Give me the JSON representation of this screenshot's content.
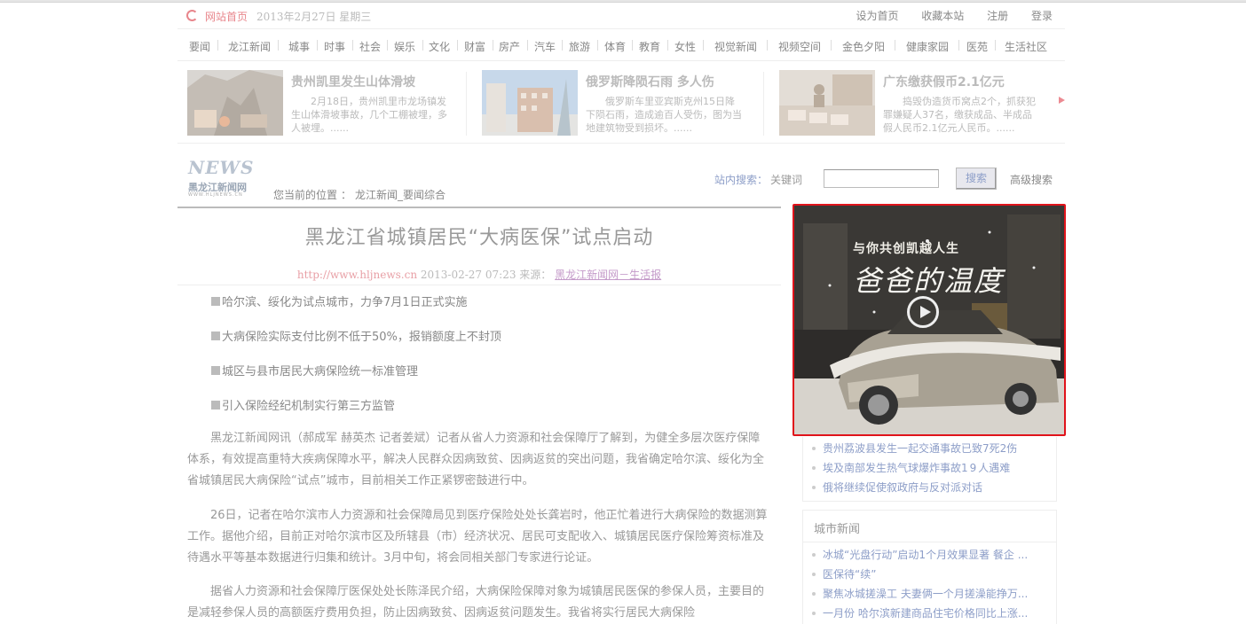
{
  "topbar": {
    "home": "网站首页",
    "date": "2013年2月27日 星期三",
    "links": [
      "设为首页",
      "收藏本站",
      "注册",
      "登录"
    ]
  },
  "nav": [
    "要闻",
    "龙江新闻",
    "城事",
    "时事",
    "社会",
    "娱乐",
    "文化",
    "财富",
    "房产",
    "汽车",
    "旅游",
    "体育",
    "教育",
    "女性",
    "视觉新闻",
    "视频空间",
    "金色夕阳",
    "健康家园",
    "医苑",
    "生活社区"
  ],
  "strip": [
    {
      "title": "贵州凯里发生山体滑坡",
      "summary": "2月18日，贵州凯里市龙场镇发生山体滑坡事故，几个工棚被埋，多人被埋。......"
    },
    {
      "title": "俄罗斯降陨石雨 多人伤",
      "summary": "俄罗斯车里亚宾斯克州15日降下陨石雨，造成逾百人受伤，图为当地建筑物受到损坏。......"
    },
    {
      "title": "广东缴获假币2.1亿元",
      "summary": "捣毁伪造货币窝点2个，抓获犯罪嫌疑人37名，缴获成品、半成品假人民币2.1亿元人民币。......"
    }
  ],
  "logo": {
    "word": "NEWS",
    "cn": "黑龙江新闻网",
    "url": "WWW.HLJNEWS.CN"
  },
  "breadcrumb": {
    "label": "您当前的位置",
    "sep": "：",
    "path": "龙江新闻_要闻综合"
  },
  "search": {
    "label": "站内搜索：",
    "keyword": "关键词",
    "value": "",
    "button": "搜索",
    "advanced": "高级搜索"
  },
  "article": {
    "title": "黑龙江省城镇居民“大病医保”试点启动",
    "meta_url": "http://www.hljnews.cn",
    "meta_time": "2013-02-27 07:23",
    "meta_src_label": "来源：",
    "meta_src": "黑龙江新闻网－生活报",
    "bullets": [
      "哈尔滨、绥化为试点城市，力争7月1日正式实施",
      "大病保险实际支付比例不低于50%，报销额度上不封顶",
      "城区与县市居民大病保险统一标准管理",
      "引入保险经纪机制实行第三方监管"
    ],
    "paragraphs": [
      "黑龙江新闻网讯（郝成军 赫英杰 记者姜斌）记者从省人力资源和社会保障厅了解到，为健全多层次医疗保障体系，有效提高重特大疾病保障水平，解决人民群众因病致贫、因病返贫的突出问题，我省确定哈尔滨、绥化为全省城镇居民大病保险“试点”城市，目前相关工作正紧锣密鼓进行中。",
      "26日，记者在哈尔滨市人力资源和社会保障局见到医疗保险处处长龚岩时，他正忙着进行大病保险的数据测算工作。据他介绍，目前正对哈尔滨市区及所辖县（市）经济状况、居民可支配收入、城镇居民医疗保险筹资标准及待遇水平等基本数据进行归集和统计。3月中旬，将会同相关部门专家进行论证。",
      "据省人力资源和社会保障厅医保处处长陈泽民介绍，大病保险保障对象为城镇居民医保的参保人员，主要目的是减轻参保人员的高额医疗费用负担，防止因病致贫、因病返贫问题发生。我省将实行居民大病保险"
    ]
  },
  "ad": {
    "slogan": "与你共创凯越人生",
    "title": "爸爸的温度"
  },
  "side_news": [
    {
      "text": "贵州荔波县发生一起交通事故已致7死2伤"
    },
    {
      "pre": "埃及南部发生热气球爆炸事故",
      "num": "19",
      "post": "人遇难"
    },
    {
      "text": "俄将继续促使叙政府与反对派对话"
    }
  ],
  "city_news": {
    "heading": "城市新闻",
    "items": [
      "冰城“光盘行动”启动1个月效果显著 餐企 ...",
      "医保待“续”",
      "聚焦冰城搓澡工 夫妻俩一个月搓澡能挣万...",
      "一月份 哈尔滨新建商品住宅价格同比上涨..."
    ]
  }
}
